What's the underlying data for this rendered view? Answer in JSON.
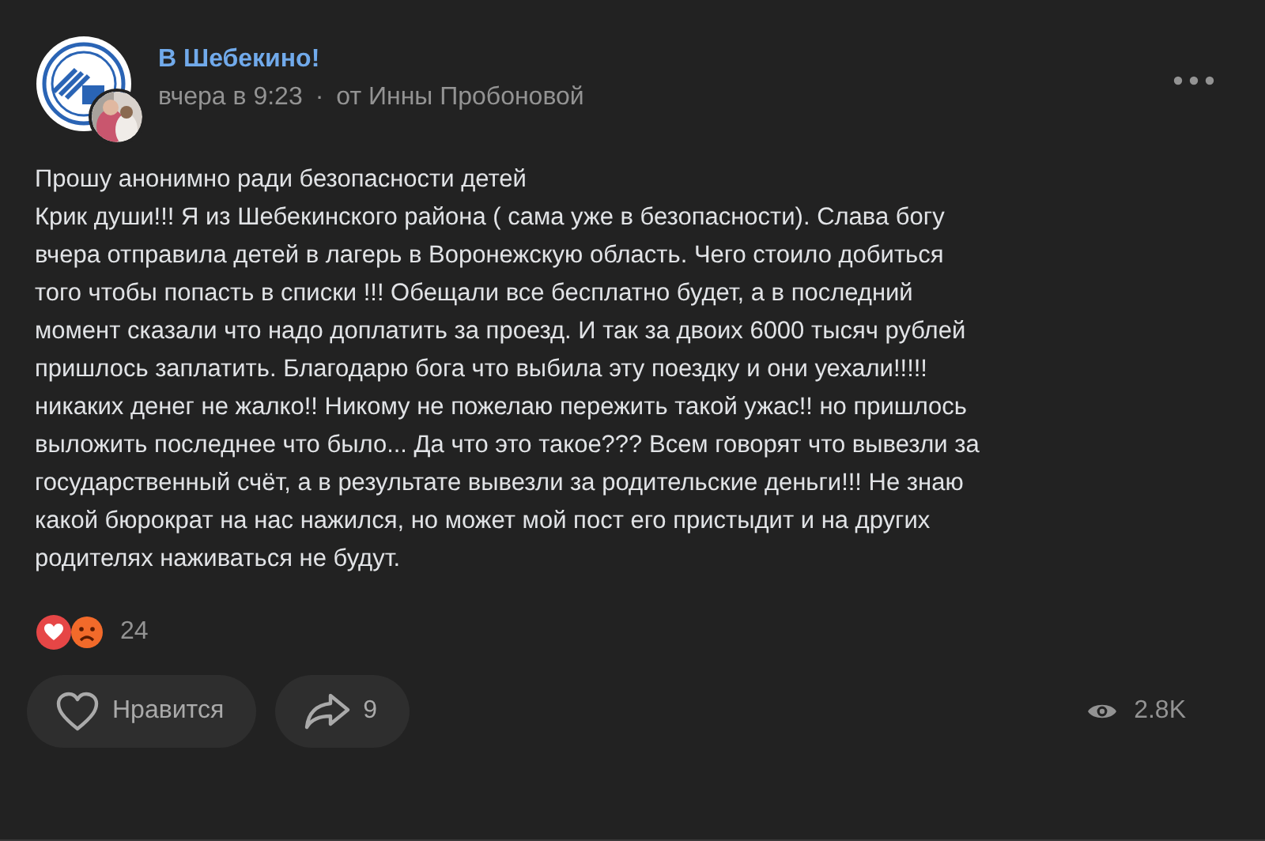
{
  "post": {
    "community": "В Шебекино!",
    "time": "вчера в 9:23",
    "separator": "·",
    "author": "от Инны Пробоновой",
    "title": "Прошу анонимно ради безопасности детей",
    "body": "Крик души!!! Я из Шебекинского района ( сама уже в безопасности). Слава богу\nвчера отправила детей в лагерь в Воронежскую область. Чего стоило добиться\nтого чтобы попасть в списки !!! Обещали все бесплатно будет, а в последний\nмомент сказали что надо доплатить за проезд. И так за двоих 6000 тысяч рублей\nпришлось заплатить. Благодарю бога что выбила эту поездку и они уехали!!!!!\nникаких денег не жалко!! Никому не пожелаю пережить такой ужас!! но пришлось\nвыложить последнее что было... Да что это такое??? Всем говорят что вывезли за\nгосударственный счёт, а в результате вывезли за родительские деньги!!! Не знаю\nкакой бюрократ на нас нажился, но может мой пост его пристыдит и на других\nродителях наживаться не будут."
  },
  "reactions": {
    "count": "24"
  },
  "actions": [
    {
      "kind": "like",
      "label": "Нравится"
    },
    {
      "kind": "share",
      "label": "9"
    }
  ],
  "views": "2.8K"
}
